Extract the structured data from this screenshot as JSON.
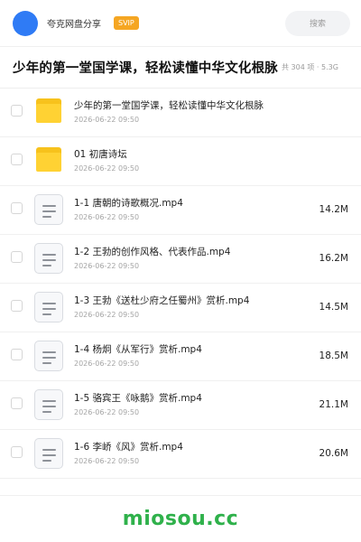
{
  "header": {
    "share_name": "夸克网盘分享",
    "badge": "SVIP",
    "search_placeholder": "搜索"
  },
  "page": {
    "title": "少年的第一堂国学课，轻松读懂中华文化根脉",
    "meta": "共 304 项 · 5.3G"
  },
  "items": [
    {
      "type": "folder",
      "name": "少年的第一堂国学课，轻松读懂中华文化根脉",
      "date": "2026-06-22 09:50",
      "size": ""
    },
    {
      "type": "folder",
      "name": "01 初唐诗坛",
      "date": "2026-06-22 09:50",
      "size": ""
    },
    {
      "type": "file",
      "name": "1-1 唐朝的诗歌概况.mp4",
      "date": "2026-06-22 09:50",
      "size": "14.2M"
    },
    {
      "type": "file",
      "name": "1-2 王勃的创作风格、代表作品.mp4",
      "date": "2026-06-22 09:50",
      "size": "16.2M"
    },
    {
      "type": "file",
      "name": "1-3 王勃《送杜少府之任蜀州》赏析.mp4",
      "date": "2026-06-22 09:50",
      "size": "14.5M"
    },
    {
      "type": "file",
      "name": "1-4 杨炯《从军行》赏析.mp4",
      "date": "2026-06-22 09:50",
      "size": "18.5M"
    },
    {
      "type": "file",
      "name": "1-5 骆宾王《咏鹅》赏析.mp4",
      "date": "2026-06-22 09:50",
      "size": "21.1M"
    },
    {
      "type": "file",
      "name": "1-6 李峤《风》赏析.mp4",
      "date": "2026-06-22 09:50",
      "size": "20.6M"
    }
  ],
  "footer": {
    "watermark": "miosou.cc"
  }
}
